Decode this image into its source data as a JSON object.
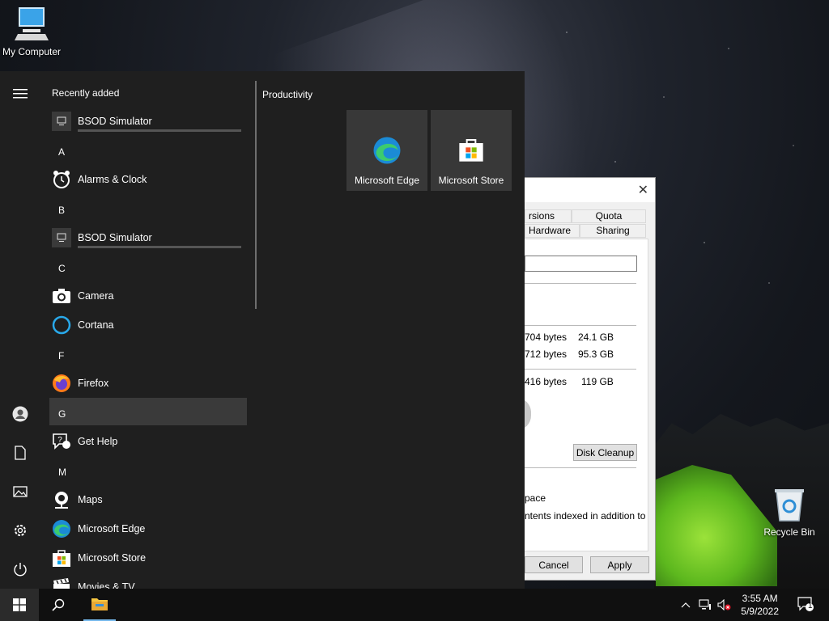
{
  "desktop": {
    "my_computer_label": "My Computer",
    "recycle_bin_label": "Recycle Bin"
  },
  "properties_window": {
    "tabs_row1": [
      "rsions",
      "Quota"
    ],
    "tabs_row2": [
      "Hardware",
      "Sharing"
    ],
    "used_bytes": "704 bytes",
    "used_gb": "24.1 GB",
    "free_bytes": "712 bytes",
    "free_gb": "95.3 GB",
    "capacity_bytes": "416 bytes",
    "capacity_gb": "119 GB",
    "disk_cleanup": "Disk Cleanup",
    "compress_text": "pace",
    "index_text": "ntents indexed in addition to",
    "cancel": "Cancel",
    "apply": "Apply"
  },
  "start_menu": {
    "recently_added": "Recently added",
    "productivity": "Productivity",
    "apps": [
      {
        "type": "app",
        "name": "BSOD Simulator",
        "icon": "monitor-icon",
        "progress": true
      },
      {
        "type": "letter",
        "name": "A"
      },
      {
        "type": "app",
        "name": "Alarms & Clock",
        "icon": "alarm-clock-icon"
      },
      {
        "type": "letter",
        "name": "B"
      },
      {
        "type": "app",
        "name": "BSOD Simulator",
        "icon": "monitor-icon",
        "progress": true
      },
      {
        "type": "letter",
        "name": "C"
      },
      {
        "type": "app",
        "name": "Camera",
        "icon": "camera-icon"
      },
      {
        "type": "app",
        "name": "Cortana",
        "icon": "cortana-icon"
      },
      {
        "type": "letter",
        "name": "F"
      },
      {
        "type": "app",
        "name": "Firefox",
        "icon": "firefox-icon"
      },
      {
        "type": "letter",
        "name": "G",
        "selected": true
      },
      {
        "type": "app",
        "name": "Get Help",
        "icon": "help-icon"
      },
      {
        "type": "letter",
        "name": "M"
      },
      {
        "type": "app",
        "name": "Maps",
        "icon": "maps-icon"
      },
      {
        "type": "app",
        "name": "Microsoft Edge",
        "icon": "edge-icon"
      },
      {
        "type": "app",
        "name": "Microsoft Store",
        "icon": "store-icon"
      },
      {
        "type": "app",
        "name": "Movies & TV",
        "icon": "movies-icon"
      }
    ],
    "tiles": [
      {
        "name": "Microsoft Edge",
        "icon": "edge-icon"
      },
      {
        "name": "Microsoft Store",
        "icon": "store-icon"
      }
    ]
  },
  "taskbar": {
    "time": "3:55 AM",
    "date": "5/9/2022",
    "notification_count": "1"
  }
}
